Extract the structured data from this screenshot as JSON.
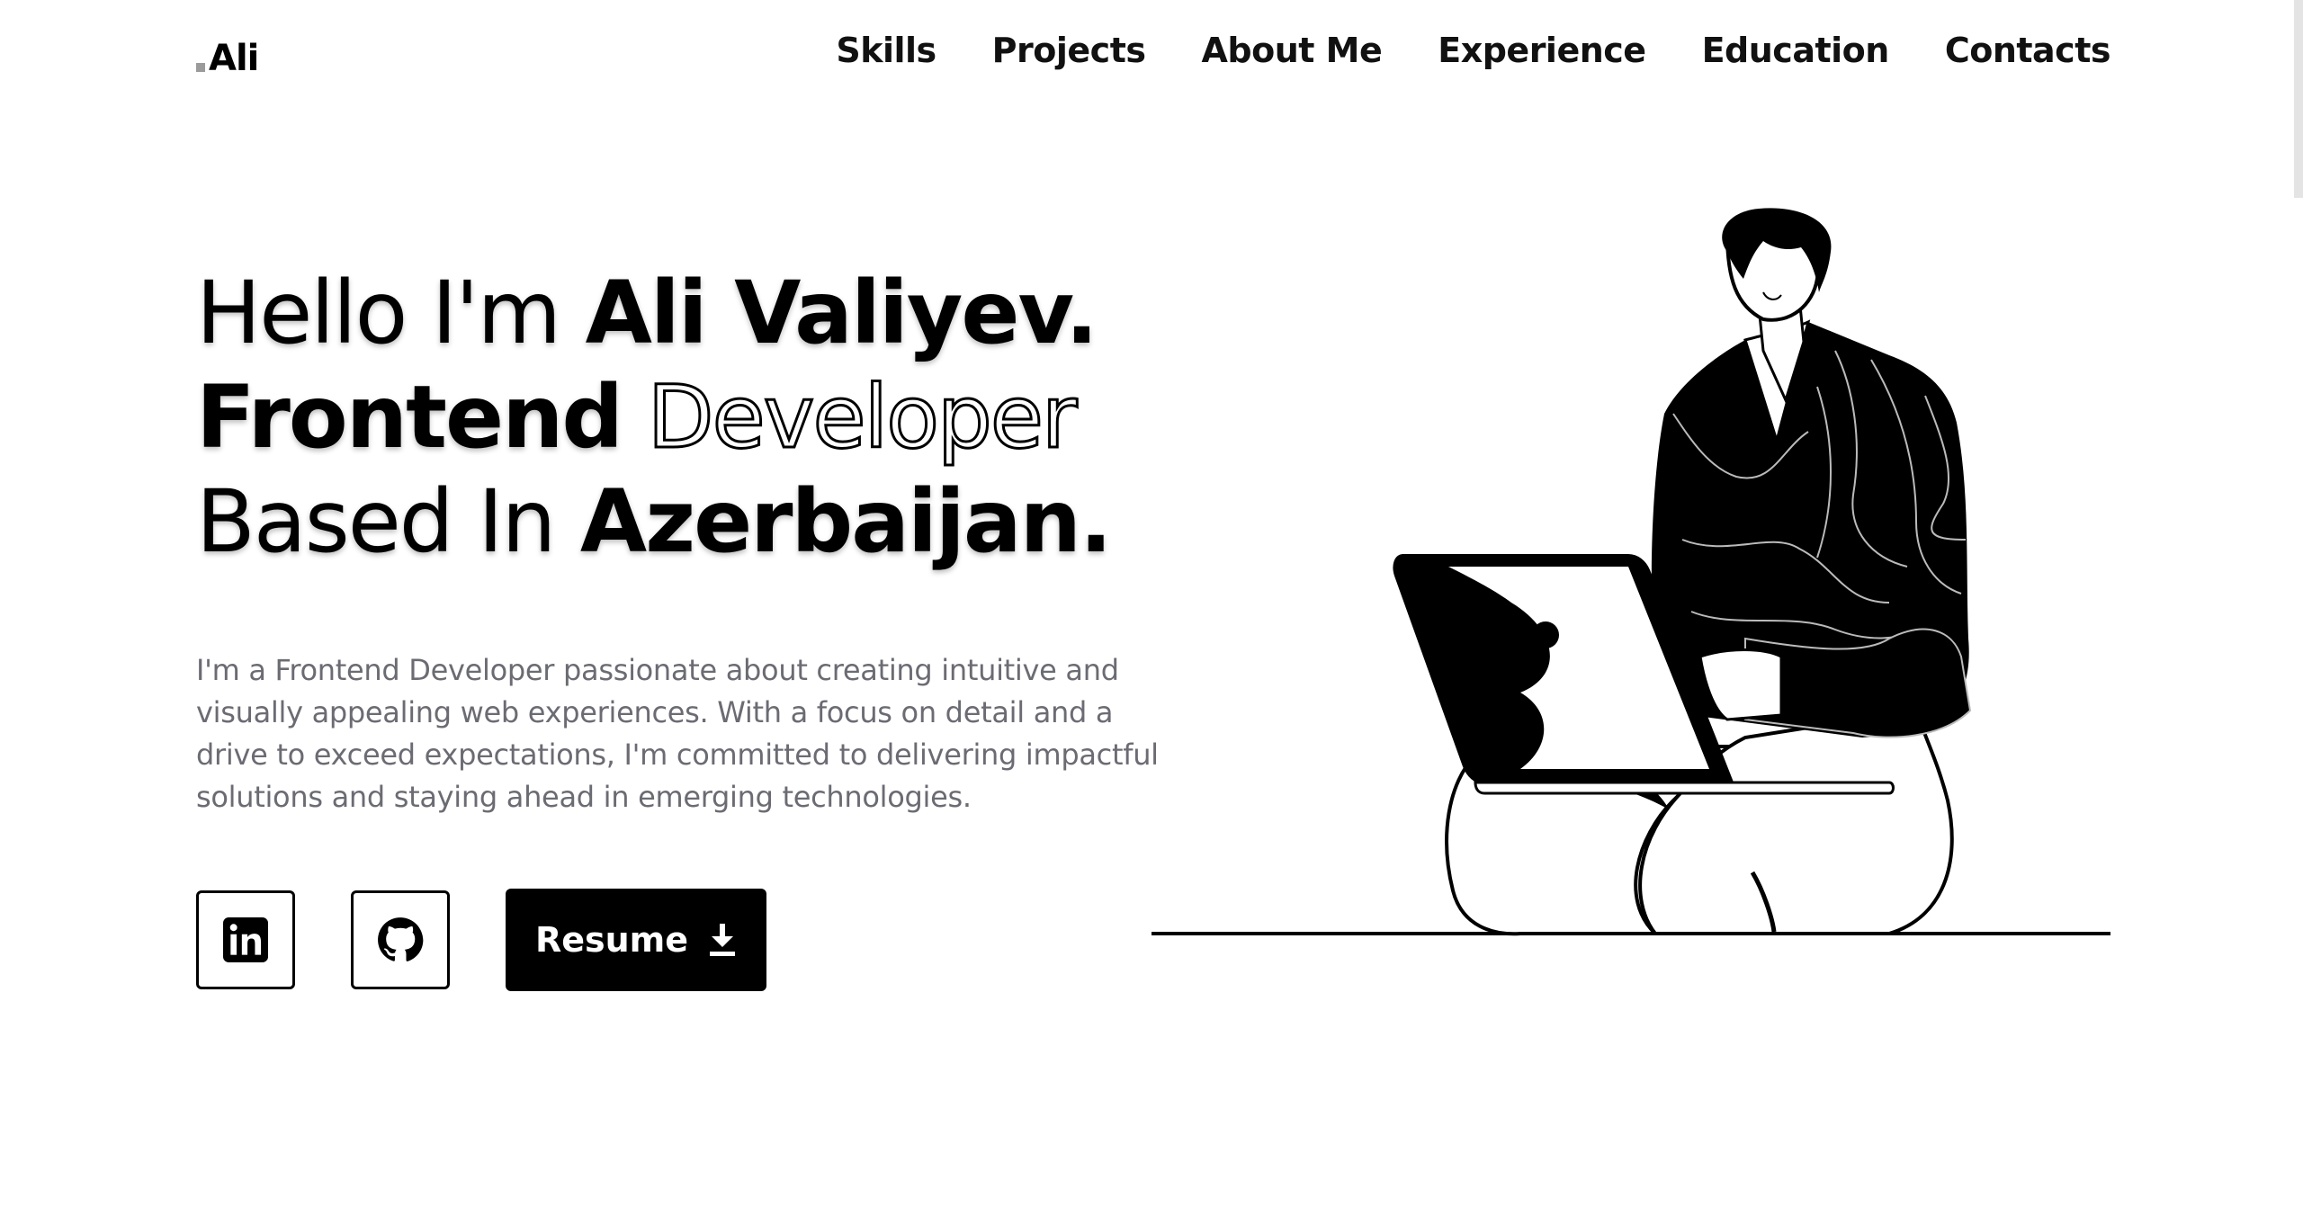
{
  "header": {
    "logo_text": "Ali",
    "nav": [
      "Skills",
      "Projects",
      "About Me",
      "Experience",
      "Education",
      "Contacts"
    ]
  },
  "hero": {
    "line1_prefix": "Hello I'm ",
    "line1_name": "Ali Valiyev.",
    "line2_bold": "Frontend",
    "line2_outline": "Developer",
    "line3_prefix": "Based In ",
    "line3_bold": "Azerbaijan.",
    "description": "I'm a Frontend Developer passionate about creating intuitive and visually appealing web experiences. With a focus on detail and a drive to exceed expectations, I'm committed to delivering impactful solutions and staying ahead in emerging technologies.",
    "resume_label": "Resume"
  },
  "icons": {
    "linkedin": "linkedin-icon",
    "github": "github-icon",
    "download": "download-icon"
  },
  "colors": {
    "text": "#000000",
    "muted": "#6b6b73",
    "background": "#ffffff",
    "button": "#000000"
  }
}
